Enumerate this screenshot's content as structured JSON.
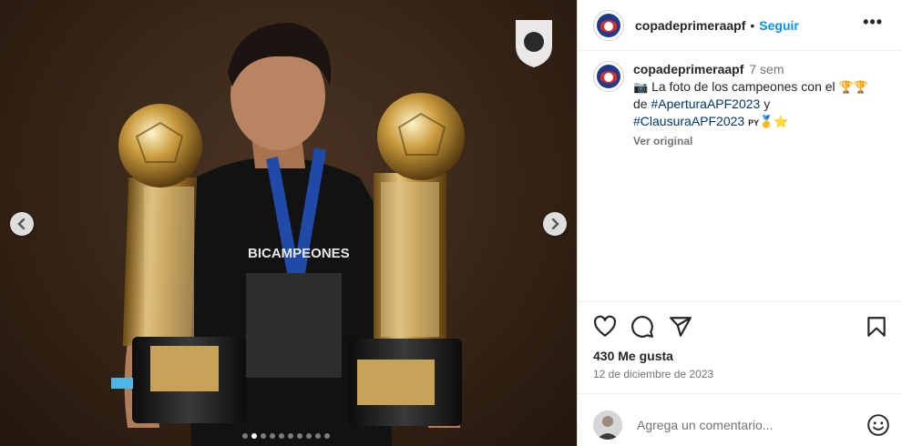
{
  "post": {
    "username": "copadeprimeraapf",
    "separator": "•",
    "follow_label": "Seguir",
    "more_label": "•••",
    "time_ago": "7 sem",
    "caption_emoji_camera": "📷",
    "caption_text_1": "La foto de los campeones con el",
    "caption_trophies": "🏆🏆",
    "caption_text_2": "de",
    "hashtag_1": "#AperturaAPF2023",
    "caption_text_3": "y",
    "hashtag_2": "#ClausuraAPF2023",
    "caption_flag": "PY",
    "caption_medal_star": "🥇⭐",
    "translate_label": "Ver original",
    "likes_label": "430 Me gusta",
    "date_label": "12 de diciembre de 2023",
    "comment_placeholder": "Agrega un comentario..."
  },
  "media": {
    "shirt_text": "BICAMPEONES",
    "carousel_total_dots": 10,
    "carousel_active_index": 1
  },
  "colors": {
    "link": "#0095f6",
    "hashtag": "#00376b",
    "secondary_text": "#737373"
  },
  "icons": [
    "chevron-left-icon",
    "chevron-right-icon",
    "more-icon",
    "heart-icon",
    "comment-icon",
    "share-icon",
    "bookmark-icon",
    "emoji-icon"
  ]
}
